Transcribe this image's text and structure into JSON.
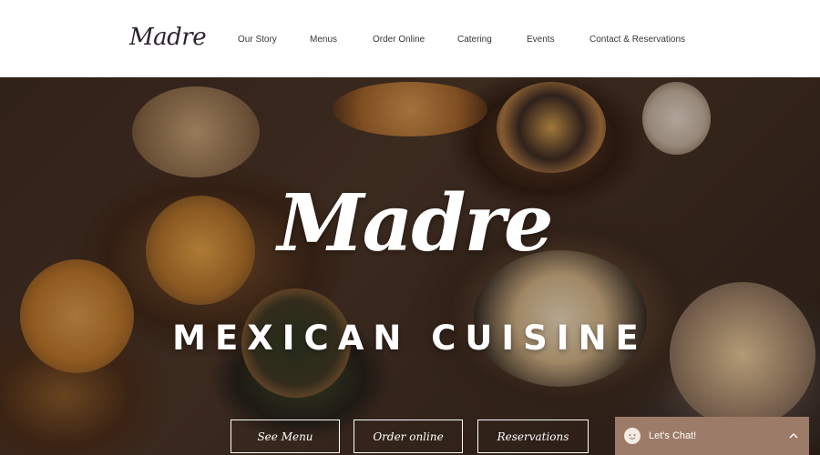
{
  "brand": {
    "logo_text": "Madre"
  },
  "nav": {
    "items": [
      {
        "label": "Our Story"
      },
      {
        "label": "Menus"
      },
      {
        "label": "Order Online"
      },
      {
        "label": "Catering"
      },
      {
        "label": "Events"
      },
      {
        "label": "Contact & Reservations"
      }
    ]
  },
  "hero": {
    "title": "Madre",
    "subtitle": "MEXICAN CUISINE",
    "buttons": [
      {
        "label": "See Menu"
      },
      {
        "label": "Order online"
      },
      {
        "label": "Reservations"
      }
    ]
  },
  "chat": {
    "label": "Let's Chat!",
    "icon": "chat-avatar-icon",
    "chevron_icon": "chevron-up-icon"
  },
  "colors": {
    "header_bg": "#ffffff",
    "logo_text": "#2c2330",
    "nav_text": "#3a3438",
    "hero_text": "#ffffff",
    "chat_bg": "#9c7b68"
  }
}
